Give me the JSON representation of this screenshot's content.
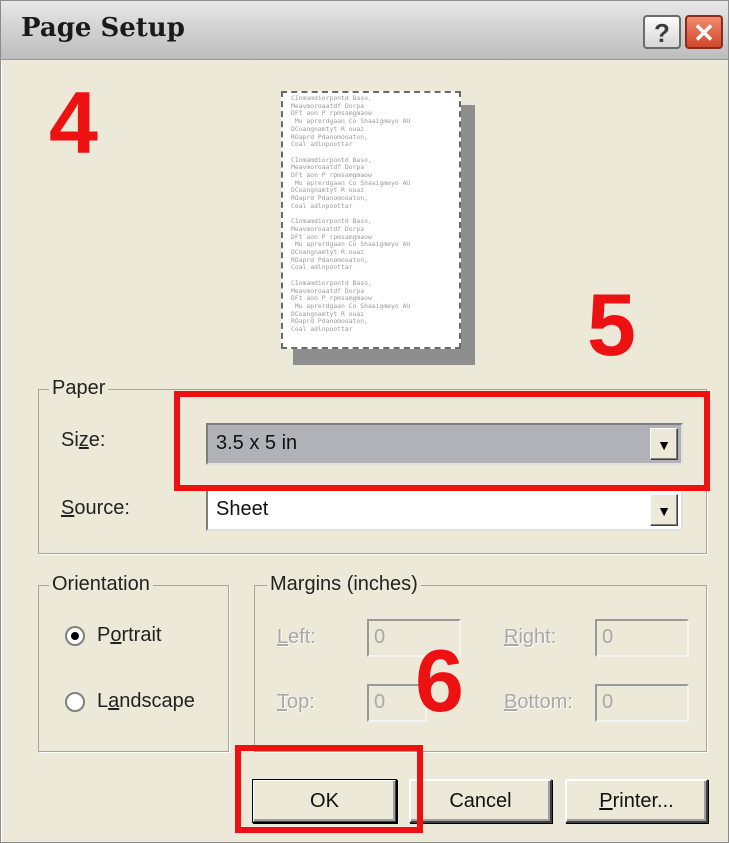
{
  "dialog": {
    "title": "Page Setup",
    "help_symbol": "?",
    "close_symbol": "✕"
  },
  "preview": {
    "text": "CInmamdiorpontd Baso,\nMeavmoroaatdf Dorpa\nDFt aon P rpmsamgmaow\n Mu aprerdgaan Co Shaaigmeyo AU\nDCoangnamtyt R ouaz\nROaprd Pdanomooaton,\nCoal adlnpoottar\n\nCInmamdiorpontd Baso,\nMeavmoroaatdf Dorpa\nDFt aon P rpmsamgmaow\n Mu aprerdgaan Co Shaaigmeyo AU\nDCoangnamtyt R ouaz\nROaprd Pdanomooaton,\nCoal adlnpoottar\n\nCInmamdiorpontd Baso,\nMeavmoroaatdf Dorpa\nDFt aon P rpmsamgmaow\n Mu aprerdgaan Co Shaaigmeyo AU\nDCoangnamtyt R ouaz\nROaprd Pdanomooaton,\nCoal adlnpoottar\n\nCInmamdiorpontd Baso,\nMeavmoroaatdf Dorpa\nDFt aon P rpmsamgmaow\n Mu aprerdgaan Co Shaaigmeyo AU\nDCoangnamtyt R ouaz\nROaprd Pdanomooaton,\nCoal adlnpoottar"
  },
  "paper": {
    "legend": "Paper",
    "size_label_pre": "Si",
    "size_label_key": "z",
    "size_label_post": "e:",
    "size_value": "3.5 x 5 in",
    "source_label_key": "S",
    "source_label_post": "ource:",
    "source_value": "Sheet"
  },
  "orientation": {
    "legend": "Orientation",
    "portrait_key": "o",
    "portrait_pre": "P",
    "portrait_post": "rtrait",
    "landscape_key": "a",
    "landscape_pre": "L",
    "landscape_post": "ndscape",
    "selected": "Portrait"
  },
  "margins": {
    "legend": "Margins (inches)",
    "left_key": "L",
    "left_post": "eft:",
    "left_value": "0",
    "right_key": "R",
    "right_post": "ight:",
    "right_value": "0",
    "top_key": "T",
    "top_post": "op:",
    "top_value": "0",
    "bottom_key": "B",
    "bottom_post": "ottom:",
    "bottom_value": "0"
  },
  "buttons": {
    "ok": "OK",
    "cancel": "Cancel",
    "printer_key": "P",
    "printer_post": "rinter..."
  },
  "annotations": {
    "step_4": "4",
    "step_5": "5",
    "step_6": "6",
    "highlight_color": "#ee1111"
  },
  "icons": [
    "help-icon",
    "close-icon",
    "dropdown-arrow-icon",
    "radio-button-icon"
  ]
}
